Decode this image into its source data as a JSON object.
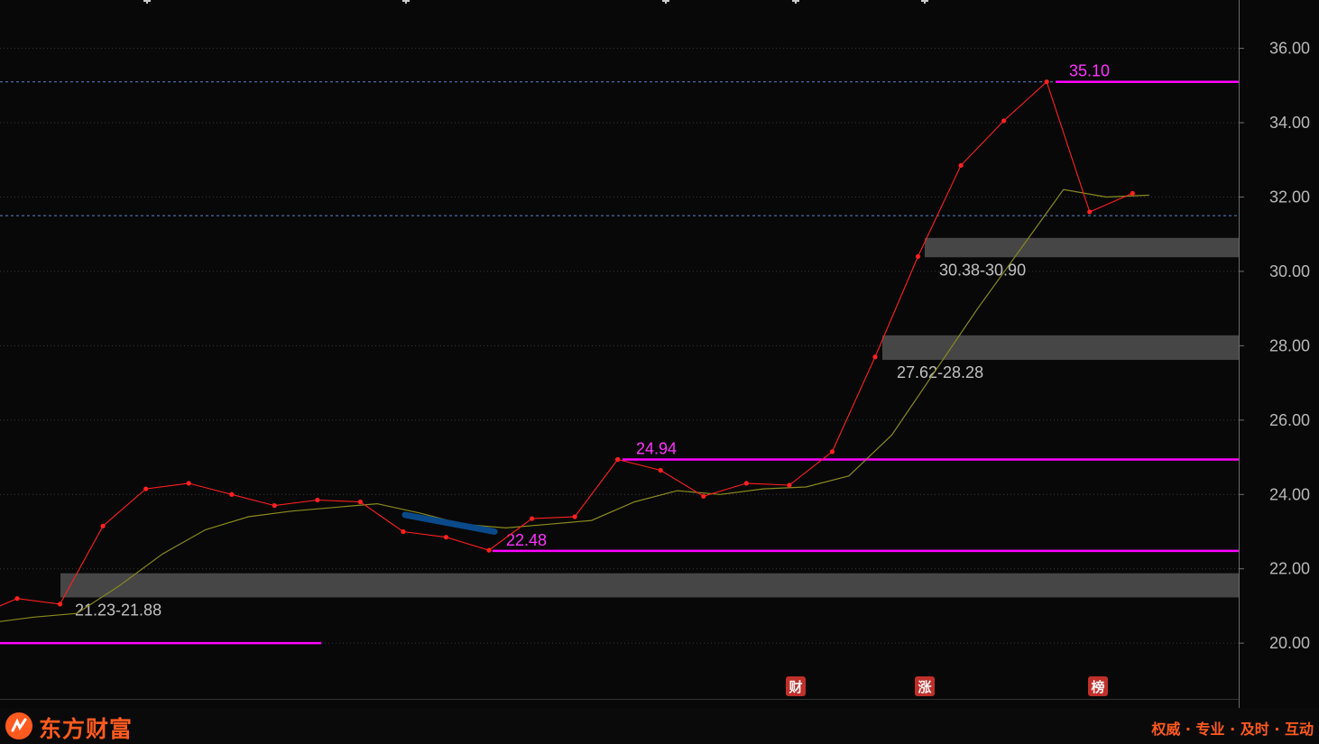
{
  "chart_data": {
    "type": "line",
    "y_ticks": [
      "20.00",
      "22.00",
      "24.00",
      "26.00",
      "28.00",
      "30.00",
      "32.00",
      "34.00",
      "36.00"
    ],
    "ylim": [
      18.5,
      37.3
    ],
    "grid": true,
    "series": [
      {
        "color": "#ff2020",
        "markers": true,
        "values": [
          21.2,
          21.05,
          23.15,
          24.15,
          24.3,
          24.0,
          23.7,
          23.85,
          23.8,
          23.0,
          22.85,
          22.5,
          23.35,
          23.4,
          24.94,
          24.65,
          23.95,
          24.3,
          24.25,
          25.15,
          27.7,
          30.4,
          32.85,
          34.05,
          35.1,
          31.6,
          32.1
        ]
      },
      {
        "color": "#8a8a20",
        "markers": false,
        "values": [
          20.55,
          20.7,
          20.8,
          21.55,
          22.4,
          23.05,
          23.4,
          23.55,
          23.65,
          23.75,
          23.5,
          23.2,
          23.1,
          23.2,
          23.3,
          23.8,
          24.1,
          24.0,
          24.15,
          24.2,
          24.5,
          25.6,
          27.3,
          29.0,
          30.6,
          32.2,
          32.0,
          32.05
        ]
      }
    ],
    "support_zones": [
      {
        "low": 21.23,
        "high": 21.88,
        "label": "21.23-21.88"
      },
      {
        "low": 27.62,
        "high": 28.28,
        "label": "27.62-28.28"
      },
      {
        "low": 30.38,
        "high": 30.9,
        "label": "30.38-30.90"
      }
    ],
    "level_lines": [
      {
        "value": 35.1,
        "label": "35.10"
      },
      {
        "value": 24.94,
        "label": "24.94"
      },
      {
        "value": 22.48,
        "label": "22.48"
      },
      {
        "value": 20.0,
        "label": ""
      }
    ],
    "dashed_lines": [
      35.1,
      31.5
    ],
    "trend_segment": {
      "from": 23.45,
      "to": 23.0,
      "color": "#0a4a8a"
    },
    "event_markers": [
      "财",
      "涨",
      "榜"
    ]
  },
  "footer": {
    "brand": "东方财富",
    "slogan": "权威 · 专业 · 及时 · 互动"
  },
  "colors": {
    "background": "#080808",
    "level_line": "#ff00ff",
    "zone": "#4a4a4a",
    "dashed": "#6fa0ff",
    "brand": "#ff5a1f",
    "event_marker_bg": "#c0302a"
  }
}
